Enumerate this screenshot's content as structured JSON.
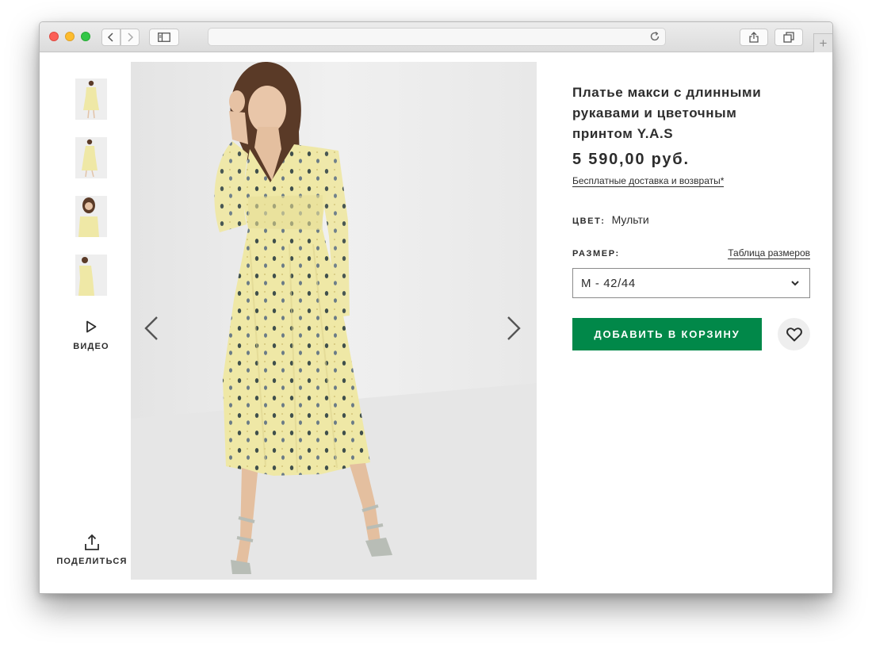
{
  "product": {
    "title": "Платье макси с длинными рукавами и цветочным принтом Y.A.S",
    "price": "5 590,00 руб.",
    "delivery_link": "Бесплатные доставка и возвраты",
    "delivery_mark": "*",
    "color_label": "ЦВЕТ:",
    "color_value": "Мульти",
    "size_label": "РАЗМЕР:",
    "size_chart_link": "Таблица размеров",
    "size_selected": "M - 42/44",
    "add_to_cart": "ДОБАВИТЬ В КОРЗИНУ"
  },
  "gallery": {
    "video_label": "ВИДЕО",
    "share_label": "ПОДЕЛИТЬСЯ",
    "thumbnail_count": 4
  },
  "colors": {
    "accent_green": "#018849",
    "text": "#2d2d2d",
    "dress": "#efe8a6",
    "photo_bg": "#ececec"
  },
  "icons": [
    "back-arrow-icon",
    "forward-arrow-icon",
    "sidebar-icon",
    "reload-icon",
    "share-icon",
    "tabs-icon",
    "plus-icon",
    "play-icon",
    "upload-icon",
    "chevron-left-icon",
    "chevron-right-icon",
    "chevron-down-icon",
    "heart-icon"
  ]
}
